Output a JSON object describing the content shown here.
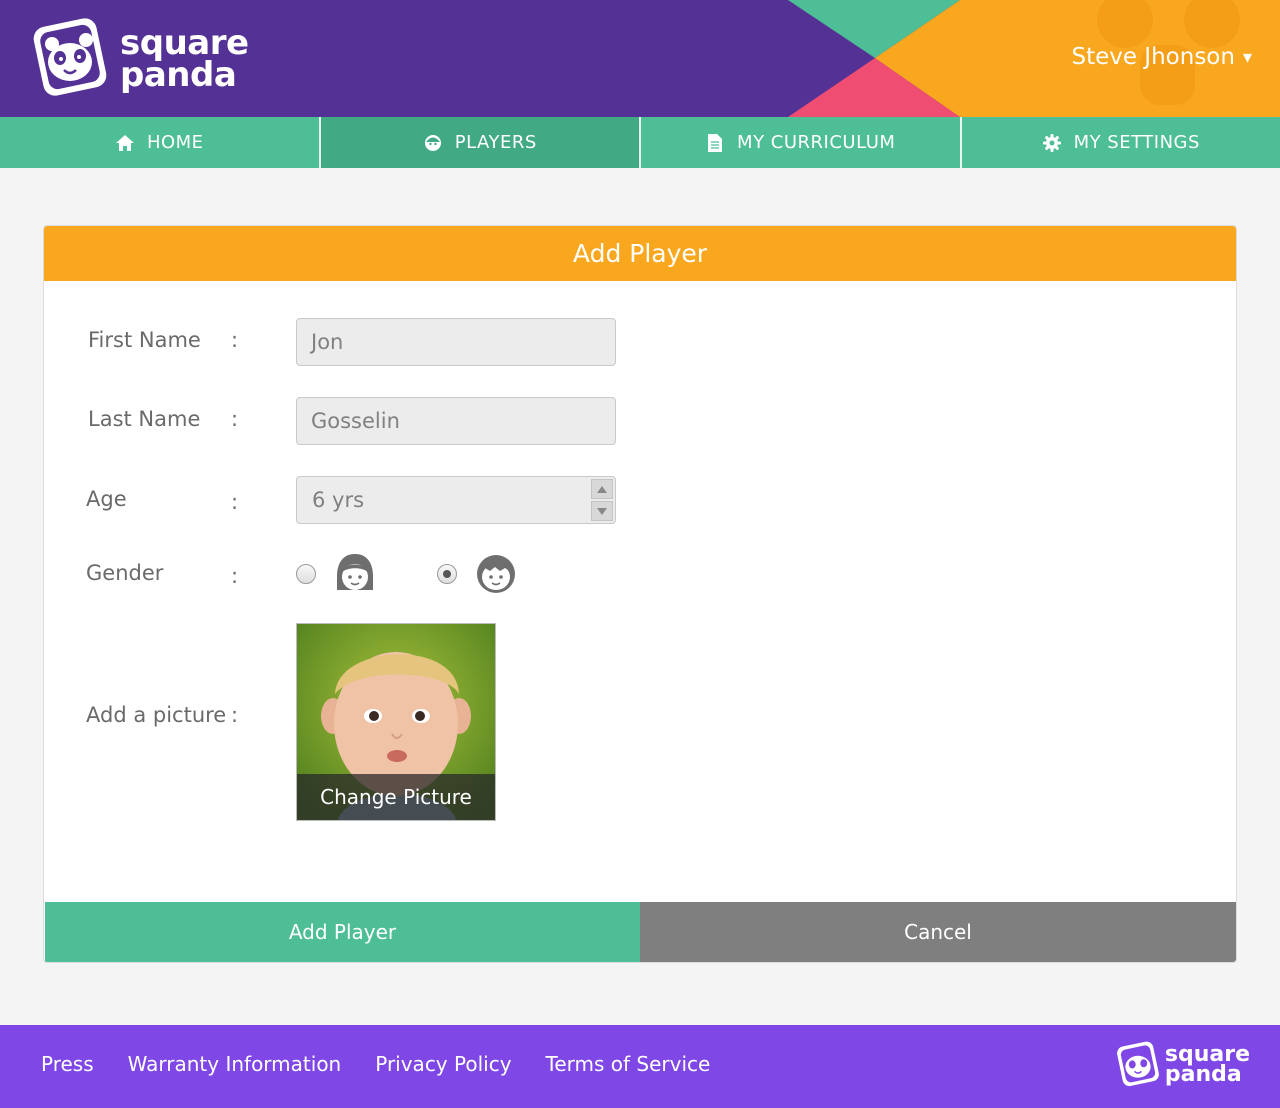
{
  "brand": {
    "line1": "square",
    "line2": "panda",
    "colors": {
      "purple": "#533195",
      "green": "#4dbe95",
      "orange": "#f8a71f",
      "pink": "#ef4d72",
      "footer": "#7f48e6"
    }
  },
  "user": {
    "name": "Steve Jhonson",
    "caret": "▾"
  },
  "nav": [
    {
      "label": "HOME",
      "icon": "home-icon",
      "active": false
    },
    {
      "label": "PLAYERS",
      "icon": "player-face-icon",
      "active": true
    },
    {
      "label": "MY CURRICULUM",
      "icon": "document-icon",
      "active": false
    },
    {
      "label": "MY SETTINGS",
      "icon": "gear-icon",
      "active": false
    }
  ],
  "form": {
    "title": "Add Player",
    "colon": ":",
    "first_name_label": "First Name",
    "first_name_value": "Jon",
    "last_name_label": "Last Name",
    "last_name_value": "Gosselin",
    "age_label": "Age",
    "age_value": "6 yrs",
    "gender_label": "Gender",
    "gender_options": [
      {
        "icon": "girl-face-icon",
        "checked": false
      },
      {
        "icon": "boy-face-icon",
        "checked": true
      }
    ],
    "picture_label": "Add a picture",
    "change_picture": "Change Picture",
    "submit_label": "Add Player",
    "cancel_label": "Cancel"
  },
  "footer": {
    "links": [
      "Press",
      "Warranty Information",
      "Privacy Policy",
      "Terms of Service"
    ]
  }
}
